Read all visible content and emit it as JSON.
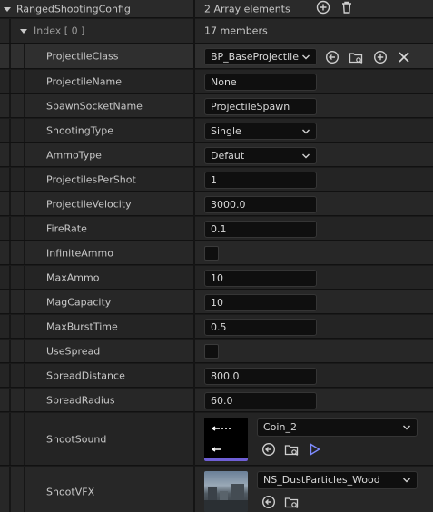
{
  "header": {
    "title": "RangedShootingConfig",
    "array_count": "2 Array elements"
  },
  "index_row": {
    "label": "Index [ 0 ]",
    "members": "17 members"
  },
  "properties": {
    "projectile_class": {
      "label": "ProjectileClass",
      "value": "BP_BaseProjectile"
    },
    "projectile_name": {
      "label": "ProjectileName",
      "value": "None"
    },
    "spawn_socket_name": {
      "label": "SpawnSocketName",
      "value": "ProjectileSpawn"
    },
    "shooting_type": {
      "label": "ShootingType",
      "value": "Single"
    },
    "ammo_type": {
      "label": "AmmoType",
      "value": "Defaut"
    },
    "projectiles_per_shot": {
      "label": "ProjectilesPerShot",
      "value": "1"
    },
    "projectile_velocity": {
      "label": "ProjectileVelocity",
      "value": "3000.0"
    },
    "fire_rate": {
      "label": "FireRate",
      "value": "0.1"
    },
    "infinite_ammo": {
      "label": "InfiniteAmmo",
      "checked": false
    },
    "max_ammo": {
      "label": "MaxAmmo",
      "value": "10"
    },
    "mag_capacity": {
      "label": "MagCapacity",
      "value": "10"
    },
    "max_burst_time": {
      "label": "MaxBurstTime",
      "value": "0.5"
    },
    "use_spread": {
      "label": "UseSpread",
      "checked": false
    },
    "spread_distance": {
      "label": "SpreadDistance",
      "value": "800.0"
    },
    "spread_radius": {
      "label": "SpreadRadius",
      "value": "60.0"
    },
    "shoot_sound": {
      "label": "ShootSound",
      "value": "Coin_2"
    },
    "shoot_vfx": {
      "label": "ShootVFX",
      "value": "NS_DustParticles_Wood"
    }
  },
  "colors": {
    "accent_underline": "#6f5fd6",
    "play_icon": "#7f8cff"
  }
}
